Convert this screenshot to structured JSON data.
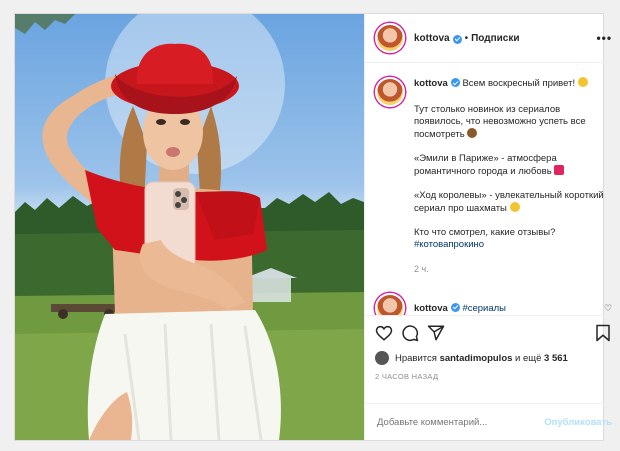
{
  "post": {
    "username": "kottova",
    "header": {
      "separator": "•",
      "follow_label": "Подписки",
      "more_label": "•••"
    },
    "caption": {
      "line1": "Всем воскресный привет!",
      "para2": "Тут столько новинок из сериалов появилось, что невозможно успеть все посмотреть",
      "para3": "«Эмили в Париже» - атмосфера романтичного города и любовь",
      "para4": "«Ход королевы» - увлекательный короткий сериал про шахматы",
      "para5_text": "Кто что смотрел, какие отзывы?",
      "para5_hashtag": "#котовапрокино",
      "time_ago": "2 ч."
    },
    "comment": {
      "username": "kottova",
      "hashtag": "#сериалы"
    },
    "likes": {
      "prefix": "Нравится",
      "user": "santadimopulos",
      "middle": "и ещё",
      "count": "3 561"
    },
    "date": "2 ЧАСОВ НАЗАД",
    "add_comment": {
      "placeholder": "Добавьте комментарий...",
      "publish_label": "Опубликовать"
    }
  },
  "colors": {
    "accent": "#3897f0",
    "hashtag": "#00376b",
    "publish_disabled": "#b2dffc",
    "hat_red": "#c8161d"
  },
  "icons": [
    "verified-badge-icon",
    "heart-icon",
    "comment-icon",
    "share-icon",
    "bookmark-icon",
    "more-icon"
  ]
}
